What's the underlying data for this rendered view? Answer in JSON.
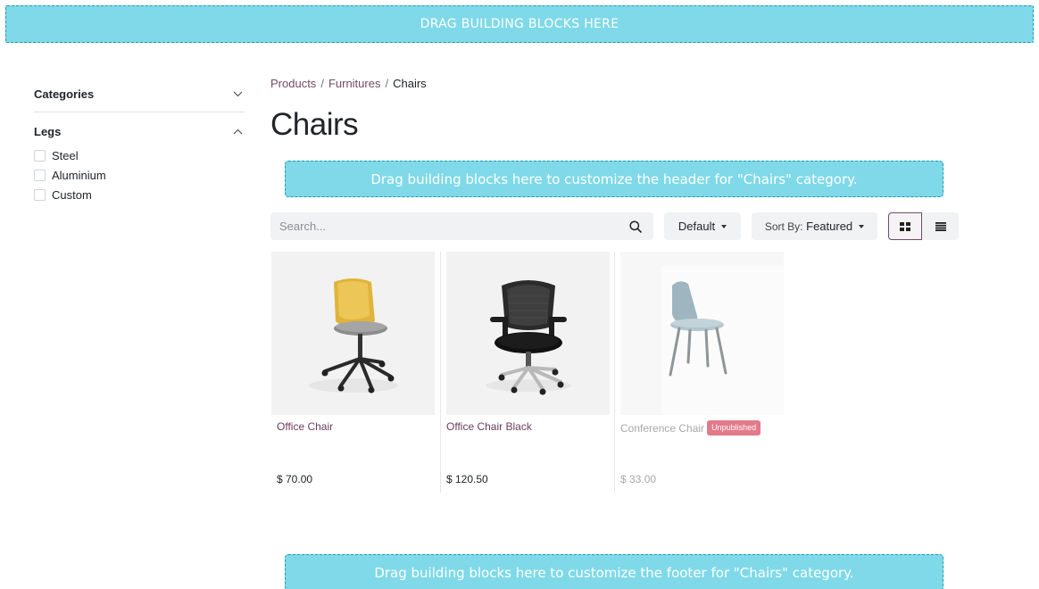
{
  "drop_zones": {
    "top": "DRAG BUILDING BLOCKS HERE",
    "header": "Drag building blocks here to customize the header for \"Chairs\" category.",
    "footer": "Drag building blocks here to customize the footer for \"Chairs\" category."
  },
  "sidebar": {
    "facets": [
      {
        "label": "Categories",
        "expanded": false,
        "icon": "chevron-down-icon"
      },
      {
        "label": "Legs",
        "expanded": true,
        "icon": "chevron-up-icon",
        "options": [
          {
            "label": "Steel",
            "checked": false
          },
          {
            "label": "Aluminium",
            "checked": false
          },
          {
            "label": "Custom",
            "checked": false
          }
        ]
      }
    ]
  },
  "breadcrumb": {
    "items": [
      "Products",
      "Furnitures",
      "Chairs"
    ],
    "separator": "/"
  },
  "page_title": "Chairs",
  "toolbar": {
    "search_placeholder": "Search...",
    "search_icon": "search-icon",
    "pricelist_label": "Default",
    "sort_prefix": "Sort By:",
    "sort_value": "Featured",
    "view_modes": {
      "grid": "grid-view-icon",
      "list": "list-view-icon",
      "active": "grid"
    }
  },
  "products": [
    {
      "name": "Office Chair",
      "price": "$ 70.00",
      "published": true
    },
    {
      "name": "Office Chair Black",
      "price": "$ 120.50",
      "published": true
    },
    {
      "name": "Conference Chair",
      "price": "$ 33.00",
      "published": false,
      "badge": "Unpublished"
    }
  ],
  "colors": {
    "primary": "#714b67",
    "drop_zone_bg": "#7fd9e8",
    "drop_zone_border": "#1a9bb4",
    "badge_bg": "#e37a8a",
    "toolbar_bg": "#f1f2f4"
  }
}
